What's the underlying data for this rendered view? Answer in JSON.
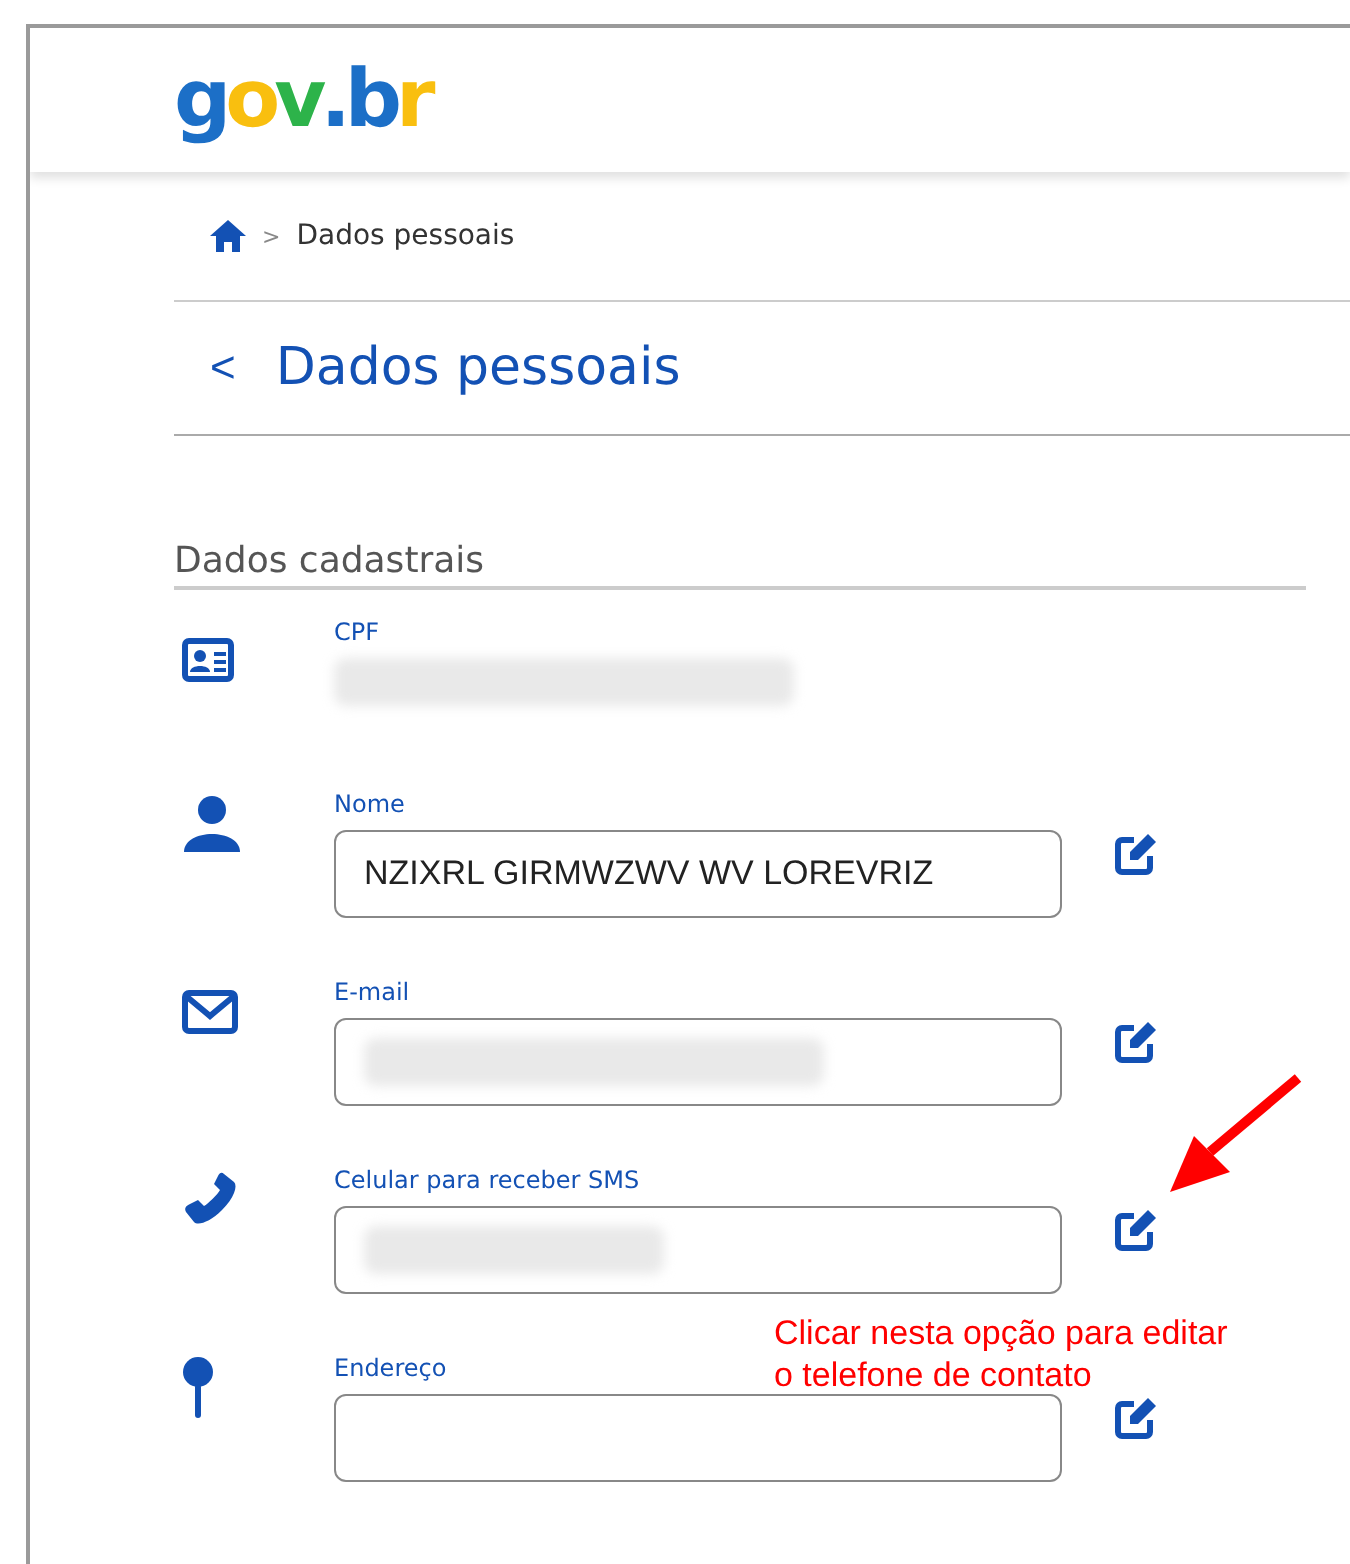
{
  "logo": [
    {
      "text": "g",
      "color": "#1c6fc7"
    },
    {
      "text": "o",
      "color": "#f9bf0f"
    },
    {
      "text": "v",
      "color": "#2db34a"
    },
    {
      "text": ".",
      "color": "#1c6fc7"
    },
    {
      "text": "b",
      "color": "#1c6fc7"
    },
    {
      "text": "r",
      "color": "#f9bf0f"
    }
  ],
  "breadcrumb": {
    "separator": ">",
    "current": "Dados pessoais"
  },
  "page_title": {
    "back": "<",
    "title": "Dados pessoais"
  },
  "section": "Dados cadastrais",
  "fields": [
    {
      "kind": "id",
      "label": "CPF",
      "boxed": false,
      "redacted": true,
      "editable": false
    },
    {
      "kind": "person",
      "label": "Nome",
      "value": "NZIXRL GIRMWZWV WV LOREVRIZ",
      "boxed": true,
      "redacted": false,
      "editable": true
    },
    {
      "kind": "mail",
      "label": "E-mail",
      "boxed": true,
      "redacted": true,
      "editable": true
    },
    {
      "kind": "phone",
      "label": "Celular para receber SMS",
      "boxed": true,
      "redacted": true,
      "editable": true
    },
    {
      "kind": "pin",
      "label": "Endereço",
      "boxed": true,
      "redacted": false,
      "editable": true
    }
  ],
  "annotation": {
    "lines": [
      "Clicar nesta opção para editar",
      "o telefone de contato"
    ]
  }
}
